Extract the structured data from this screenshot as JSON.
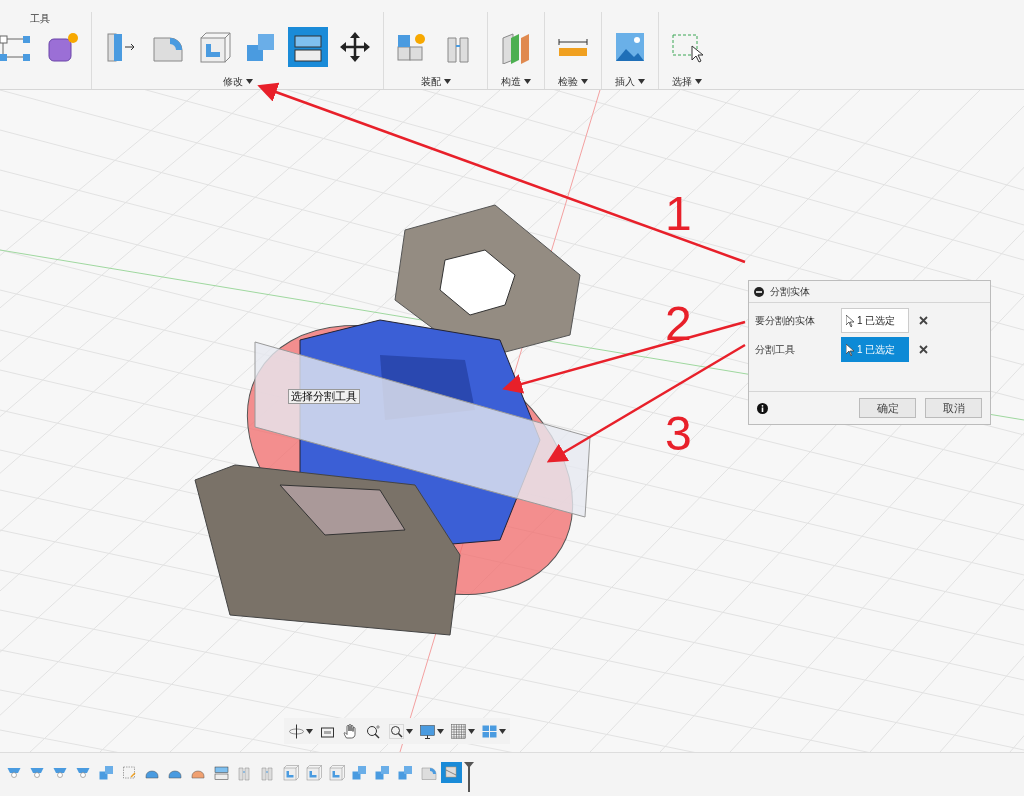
{
  "toolbar": {
    "groups": [
      {
        "label": "工具",
        "kind": "tab",
        "tools": [
          {
            "kind": "constraints",
            "selected": false
          },
          {
            "kind": "create-body",
            "selected": false
          }
        ]
      },
      {
        "label": "修改",
        "kind": "dropdown",
        "tools": [
          {
            "kind": "press-pull",
            "selected": false
          },
          {
            "kind": "fillet",
            "selected": false
          },
          {
            "kind": "shell",
            "selected": false
          },
          {
            "kind": "combine",
            "selected": false
          },
          {
            "kind": "split",
            "selected": true
          },
          {
            "kind": "move",
            "selected": false
          }
        ]
      },
      {
        "label": "装配",
        "kind": "dropdown",
        "tools": [
          {
            "kind": "new-component",
            "selected": false
          },
          {
            "kind": "joint",
            "selected": false
          }
        ]
      },
      {
        "label": "构造",
        "kind": "dropdown",
        "tools": [
          {
            "kind": "plane",
            "selected": false
          }
        ]
      },
      {
        "label": "检验",
        "kind": "dropdown",
        "tools": [
          {
            "kind": "measure",
            "selected": false
          }
        ]
      },
      {
        "label": "插入",
        "kind": "dropdown",
        "tools": [
          {
            "kind": "image",
            "selected": false
          }
        ]
      },
      {
        "label": "选择",
        "kind": "dropdown",
        "tools": [
          {
            "kind": "select",
            "selected": false
          }
        ]
      }
    ]
  },
  "tooltip": "选择分割工具",
  "annotations": [
    "1",
    "2",
    "3"
  ],
  "dialog": {
    "title": "分割实体",
    "rows": [
      {
        "label": "要分割的实体",
        "value": "1 已选定",
        "selected": false
      },
      {
        "label": "分割工具",
        "value": "1 已选定",
        "selected": true
      }
    ],
    "buttons": [
      "确定",
      "取消"
    ]
  },
  "navbar": [
    {
      "kind": "orbit",
      "menu": true
    },
    {
      "kind": "look-at",
      "menu": false
    },
    {
      "kind": "pan",
      "menu": false
    },
    {
      "kind": "zoom",
      "menu": false
    },
    {
      "kind": "fit",
      "menu": true
    },
    {
      "kind": "display",
      "menu": true
    },
    {
      "kind": "grid",
      "menu": true
    },
    {
      "kind": "viewports",
      "menu": true
    }
  ],
  "timeline": [
    {
      "kind": "sketch",
      "selected": false
    },
    {
      "kind": "sketch",
      "selected": false
    },
    {
      "kind": "sketch",
      "selected": false
    },
    {
      "kind": "sketch",
      "selected": false
    },
    {
      "kind": "combine",
      "selected": false
    },
    {
      "kind": "sketch-edit",
      "selected": false
    },
    {
      "kind": "bend",
      "selected": false
    },
    {
      "kind": "bend",
      "selected": false
    },
    {
      "kind": "bend-orange",
      "selected": false
    },
    {
      "kind": "split",
      "selected": false
    },
    {
      "kind": "joint",
      "selected": false
    },
    {
      "kind": "joint",
      "selected": false
    },
    {
      "kind": "shell",
      "selected": false
    },
    {
      "kind": "shell",
      "selected": false
    },
    {
      "kind": "shell",
      "selected": false
    },
    {
      "kind": "combine",
      "selected": false
    },
    {
      "kind": "combine",
      "selected": false
    },
    {
      "kind": "combine",
      "selected": false
    },
    {
      "kind": "fillet",
      "selected": false
    },
    {
      "kind": "split-body",
      "selected": true
    }
  ]
}
